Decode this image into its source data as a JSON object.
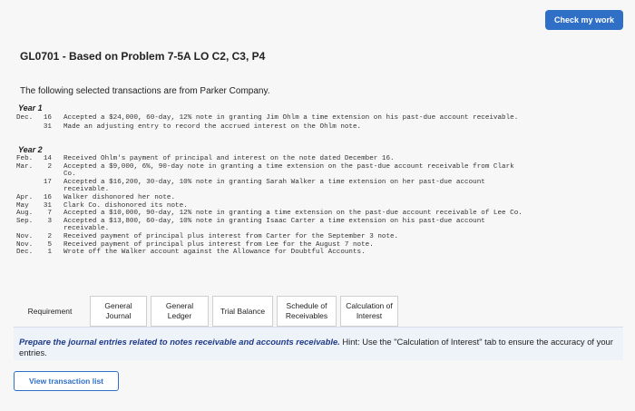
{
  "header": {
    "check_label": "Check my work"
  },
  "problem": {
    "title": "GL0701 - Based on Problem 7-5A LO C2, C3, P4",
    "intro": "The following selected transactions are from Parker Company."
  },
  "year1": {
    "label": "Year 1",
    "rows": [
      {
        "month": "Dec.",
        "day": "16",
        "text": "Accepted a $24,000, 60-day, 12% note in granting Jim Ohlm a time extension on his past-due account receivable."
      },
      {
        "month": "",
        "day": "31",
        "text": "Made an adjusting entry to record the accrued interest on the Ohlm note."
      }
    ]
  },
  "year2": {
    "label": "Year 2",
    "rows": [
      {
        "month": "Feb.",
        "day": "14",
        "text": "Received Ohlm's payment of principal and interest on the note dated December 16."
      },
      {
        "month": "Mar.",
        "day": "2",
        "text": "Accepted a $9,000, 6%, 90-day note in granting a time extension on the past-due account receivable from Clark"
      },
      {
        "month": "",
        "day": "",
        "text": "Co."
      },
      {
        "month": "",
        "day": "17",
        "text": "Accepted a $16,200, 30-day, 10% note in granting Sarah Walker a time extension on her past-due account"
      },
      {
        "month": "",
        "day": "",
        "text": "receivable."
      },
      {
        "month": "Apr.",
        "day": "16",
        "text": "Walker dishonored her note."
      },
      {
        "month": "May",
        "day": "31",
        "text": "Clark Co. dishonored its note."
      },
      {
        "month": "Aug.",
        "day": "7",
        "text": "Accepted a $10,000, 90-day, 12% note in granting a time extension on the past-due account receivable of Lee Co."
      },
      {
        "month": "Sep.",
        "day": "3",
        "text": "Accepted a $13,800, 60-day, 10% note in granting Isaac Carter a time extension on his past-due account"
      },
      {
        "month": "",
        "day": "",
        "text": "receivable."
      },
      {
        "month": "Nov.",
        "day": "2",
        "text": "Received payment of principal plus interest from Carter for the September 3 note."
      },
      {
        "month": "Nov.",
        "day": "5",
        "text": "Received payment of principal plus interest from Lee for the August 7 note."
      },
      {
        "month": "Dec.",
        "day": "1",
        "text": "Wrote off the Walker account against the Allowance for Doubtful Accounts."
      }
    ]
  },
  "tabs": [
    {
      "label": "Requirement"
    },
    {
      "label": "General Journal"
    },
    {
      "label": "General Ledger"
    },
    {
      "label": "Trial Balance"
    },
    {
      "label": "Schedule of Receivables"
    },
    {
      "label": "Calculation of Interest"
    }
  ],
  "prompt": {
    "bold": "Prepare the journal entries related to notes receivable and accounts receivable.",
    "rest": " Hint: Use the \"Calculation of Interest\" tab to ensure the accuracy of your entries."
  },
  "footer": {
    "view_label": "View transaction list"
  },
  "colors": {
    "accent": "#2f6fc6",
    "prompt_bg": "#eef3fa"
  }
}
